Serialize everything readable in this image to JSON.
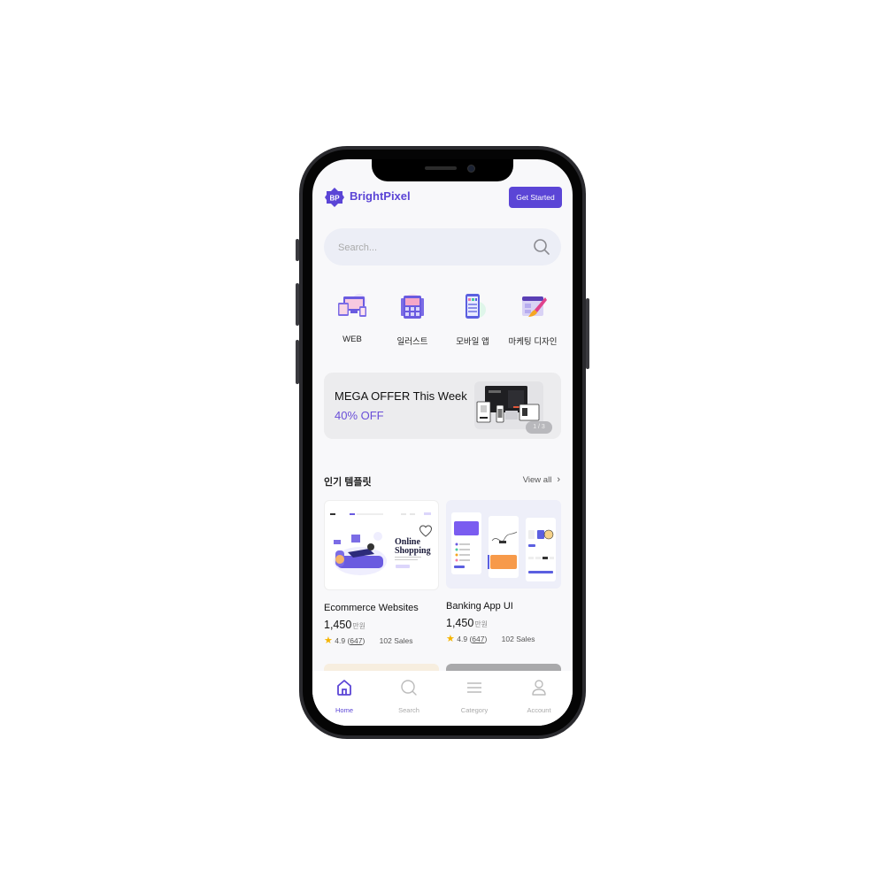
{
  "brand": {
    "logo_text": "BP",
    "name": "BrightPixel",
    "accent": "#5b45d6"
  },
  "header": {
    "cta_label": "Get Started"
  },
  "search": {
    "placeholder": "Search..."
  },
  "categories": [
    {
      "label": "WEB",
      "icon": "web-devices-icon"
    },
    {
      "label": "일러스트",
      "icon": "illustration-icon"
    },
    {
      "label": "모바일 앱",
      "icon": "mobile-app-icon"
    },
    {
      "label": "마케팅 디자인",
      "icon": "marketing-design-icon"
    }
  ],
  "banner": {
    "title": "MEGA OFFER This Week",
    "subtitle": "40% OFF",
    "pager": "1 / 3"
  },
  "popular": {
    "title": "인기 템플릿",
    "view_all": "View all",
    "items": [
      {
        "name": "Ecommerce Websites",
        "price": "1,450",
        "unit": "만원",
        "rating": "4.9",
        "reviews": "647",
        "sales": "102 Sales",
        "image_text_1": "Online",
        "image_text_2": "Shopping"
      },
      {
        "name": "Banking App UI",
        "price": "1,450",
        "unit": "만원",
        "rating": "4.9",
        "reviews": "647",
        "sales": "102 Sales"
      }
    ]
  },
  "tabbar": {
    "items": [
      {
        "label": "Home",
        "icon": "home-icon",
        "active": true
      },
      {
        "label": "Search",
        "icon": "search-icon",
        "active": false
      },
      {
        "label": "Category",
        "icon": "menu-icon",
        "active": false
      },
      {
        "label": "Account",
        "icon": "user-icon",
        "active": false
      }
    ]
  }
}
